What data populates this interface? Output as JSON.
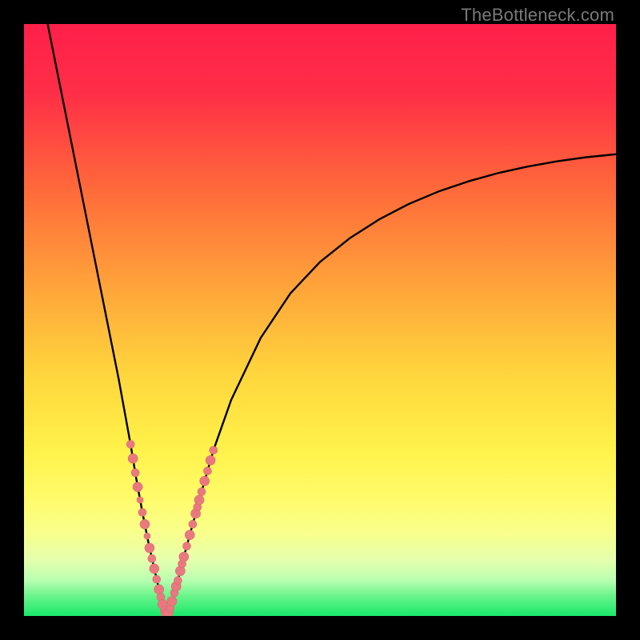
{
  "watermark": {
    "text": "TheBottleneck.com"
  },
  "colors": {
    "frame": "#000000",
    "gradient_stops": [
      {
        "offset": 0.0,
        "color": "#ff1f4a"
      },
      {
        "offset": 0.12,
        "color": "#ff2f47"
      },
      {
        "offset": 0.28,
        "color": "#ff6a3a"
      },
      {
        "offset": 0.45,
        "color": "#ffa63a"
      },
      {
        "offset": 0.6,
        "color": "#ffd83d"
      },
      {
        "offset": 0.72,
        "color": "#fff24a"
      },
      {
        "offset": 0.8,
        "color": "#fffb6a"
      },
      {
        "offset": 0.86,
        "color": "#f8ff8c"
      },
      {
        "offset": 0.905,
        "color": "#e6ffad"
      },
      {
        "offset": 0.94,
        "color": "#b8ffb0"
      },
      {
        "offset": 0.965,
        "color": "#6df58c"
      },
      {
        "offset": 1.0,
        "color": "#18e86a"
      }
    ],
    "curve": "#000000",
    "marker_fill": "#e9797f",
    "marker_stroke": "#d96a70"
  },
  "chart_data": {
    "type": "line",
    "title": "",
    "xlabel": "",
    "ylabel": "",
    "xlim": [
      0,
      100
    ],
    "ylim": [
      0,
      100
    ],
    "series": [
      {
        "name": "left-curve",
        "x": [
          4.0,
          6.0,
          8.0,
          10.0,
          12.0,
          14.0,
          16.0,
          18.0,
          19.0,
          20.0,
          21.0,
          22.0,
          22.8,
          23.4,
          24.0
        ],
        "y": [
          100.0,
          90.0,
          80.0,
          70.0,
          60.0,
          50.0,
          40.0,
          29.0,
          23.0,
          17.5,
          12.5,
          8.0,
          4.5,
          2.0,
          0.3
        ]
      },
      {
        "name": "right-curve",
        "x": [
          24.0,
          25.0,
          26.0,
          27.0,
          28.5,
          30.0,
          32.0,
          35.0,
          40.0,
          45.0,
          50.0,
          55.0,
          60.0,
          65.0,
          70.0,
          75.0,
          80.0,
          85.0,
          90.0,
          95.0,
          100.0
        ],
        "y": [
          0.3,
          2.5,
          6.0,
          10.0,
          15.5,
          21.0,
          28.0,
          36.5,
          47.0,
          54.5,
          59.8,
          63.8,
          67.0,
          69.6,
          71.7,
          73.4,
          74.8,
          75.9,
          76.8,
          77.5,
          78.0
        ]
      }
    ],
    "markers": [
      {
        "name": "left-arm-markers",
        "points": [
          {
            "x": 18.0,
            "y": 29.0,
            "size": 5
          },
          {
            "x": 18.4,
            "y": 26.6,
            "size": 6
          },
          {
            "x": 18.8,
            "y": 24.2,
            "size": 5
          },
          {
            "x": 19.2,
            "y": 21.8,
            "size": 6
          },
          {
            "x": 19.6,
            "y": 19.6,
            "size": 4
          },
          {
            "x": 20.0,
            "y": 17.5,
            "size": 5
          },
          {
            "x": 20.4,
            "y": 15.5,
            "size": 6
          },
          {
            "x": 20.8,
            "y": 13.5,
            "size": 4
          },
          {
            "x": 21.2,
            "y": 11.5,
            "size": 6
          },
          {
            "x": 21.6,
            "y": 9.7,
            "size": 5
          },
          {
            "x": 22.0,
            "y": 8.0,
            "size": 6
          },
          {
            "x": 22.4,
            "y": 6.2,
            "size": 5
          },
          {
            "x": 22.8,
            "y": 4.5,
            "size": 6
          },
          {
            "x": 23.1,
            "y": 3.2,
            "size": 5
          },
          {
            "x": 23.4,
            "y": 2.0,
            "size": 6
          }
        ]
      },
      {
        "name": "valley-floor-markers",
        "points": [
          {
            "x": 23.7,
            "y": 1.0,
            "size": 5
          },
          {
            "x": 24.0,
            "y": 0.4,
            "size": 6
          },
          {
            "x": 24.4,
            "y": 0.6,
            "size": 6
          },
          {
            "x": 24.7,
            "y": 1.3,
            "size": 5
          },
          {
            "x": 25.0,
            "y": 2.5,
            "size": 6
          },
          {
            "x": 25.4,
            "y": 3.9,
            "size": 5
          },
          {
            "x": 25.7,
            "y": 5.0,
            "size": 6
          }
        ]
      },
      {
        "name": "right-arm-markers",
        "points": [
          {
            "x": 26.0,
            "y": 6.0,
            "size": 5
          },
          {
            "x": 26.4,
            "y": 7.6,
            "size": 6
          },
          {
            "x": 26.7,
            "y": 8.8,
            "size": 5
          },
          {
            "x": 27.0,
            "y": 10.0,
            "size": 6
          },
          {
            "x": 27.5,
            "y": 11.8,
            "size": 5
          },
          {
            "x": 28.0,
            "y": 13.7,
            "size": 6
          },
          {
            "x": 28.5,
            "y": 15.5,
            "size": 5
          },
          {
            "x": 29.0,
            "y": 17.3,
            "size": 6
          },
          {
            "x": 29.3,
            "y": 18.4,
            "size": 5
          },
          {
            "x": 29.6,
            "y": 19.6,
            "size": 6
          },
          {
            "x": 30.0,
            "y": 21.0,
            "size": 5
          },
          {
            "x": 30.5,
            "y": 22.8,
            "size": 6
          },
          {
            "x": 31.0,
            "y": 24.5,
            "size": 5
          },
          {
            "x": 31.5,
            "y": 26.3,
            "size": 6
          },
          {
            "x": 32.0,
            "y": 28.0,
            "size": 5
          }
        ]
      }
    ]
  }
}
